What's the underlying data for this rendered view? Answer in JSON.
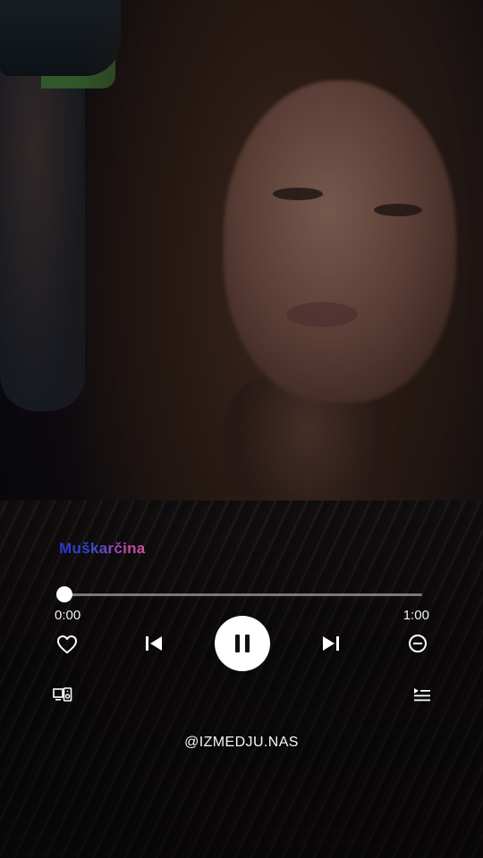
{
  "subtitle_text": "Muškarčina",
  "player": {
    "progress_fraction": 0.0,
    "elapsed": "0:00",
    "total": "1:00"
  },
  "controls": {
    "like_icon": "heart-outline-icon",
    "previous_icon": "skip-previous-icon",
    "play_pause_icon": "pause-icon",
    "next_icon": "skip-next-icon",
    "remove_icon": "minus-circle-icon",
    "devices_icon": "connect-devices-icon",
    "queue_icon": "queue-list-icon"
  },
  "credit": {
    "handle": "@IZMEDJU.NAS"
  },
  "colors": {
    "accent": "#ffffff",
    "track": "#9a9aa2",
    "subtitle_start": "#2b3bd8",
    "subtitle_end": "#e05aa8"
  }
}
